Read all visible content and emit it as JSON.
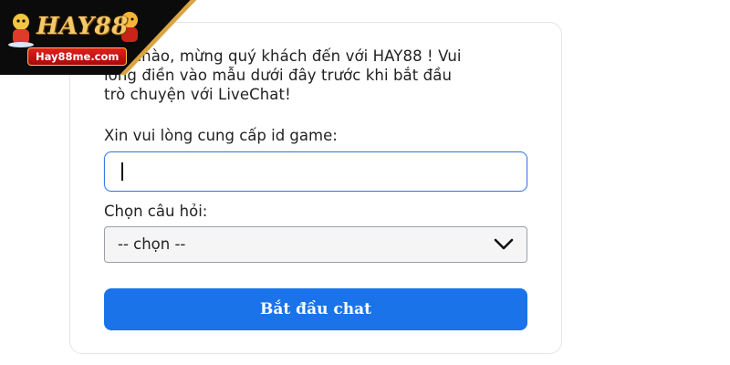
{
  "brand": {
    "name": "HAY88",
    "url": "Hay88me.com"
  },
  "chat": {
    "greeting_lines": [
      "Xin chào, mừng quý khách đến với HAY88 ! Vui",
      "lòng điền vào mẫu dưới đây trước khi bắt đầu",
      "trò chuyện với LiveChat!"
    ],
    "game_id_label": "Xin vui lòng cung cấp id game:",
    "game_id_value": "",
    "question_label": "Chọn câu hỏi:",
    "question_selected": "-- chọn --",
    "start_button": "Bắt đầu chat"
  },
  "colors": {
    "accent": "#1a73e8",
    "input_focus_border": "#3a7be3",
    "logo_gold": "#f3c969",
    "logo_red": "#d01414"
  },
  "icons": {
    "select_arrow": "chevron-down-icon"
  }
}
